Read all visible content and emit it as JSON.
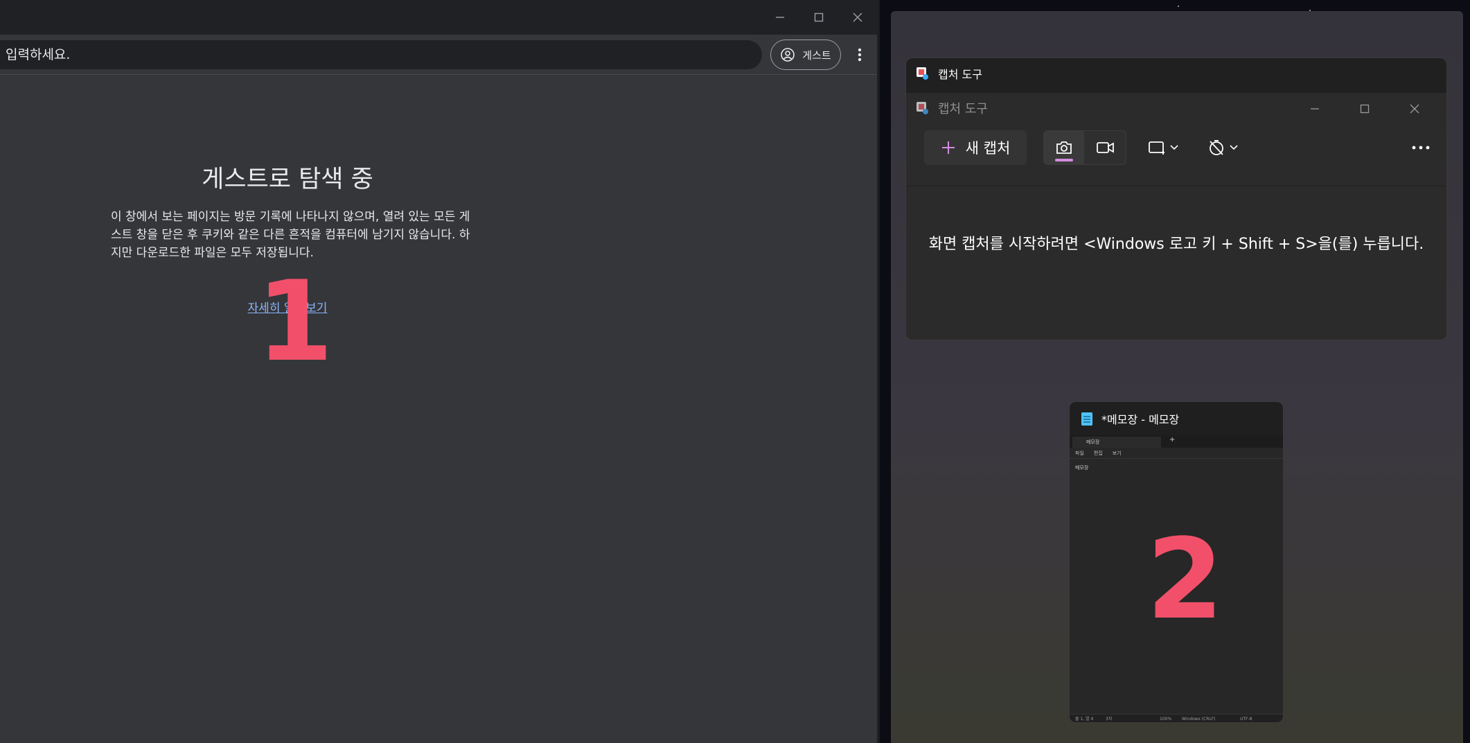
{
  "browser": {
    "omnibox_text": "입력하세요.",
    "guest_chip_label": "게스트",
    "heading": "게스트로 탐색 중",
    "description": "이 창에서 보는 페이지는 방문 기록에 나타나지 않으며, 열려 있는 모든 게스트 창을 닫은 후 쿠키와 같은 다른 흔적을 컴퓨터에 남기지 않습니다. 하지만 다운로드한 파일은 모두 저장됩니다.",
    "learn_more": "자세히 알아보기",
    "marker": "1"
  },
  "snipping_tool": {
    "thumb_title": "캡처 도구",
    "app_title": "캡처 도구",
    "new_capture_label": "새 캡처",
    "hint": "화면 캡처를 시작하려면 <Windows 로고 키 + Shift + S>을(를) 누릅니다.",
    "accent_color": "#d18ee0"
  },
  "notepad": {
    "thumb_title": "*메모장 - 메모장",
    "tab_label": "메모장",
    "menu": [
      "파일",
      "편집",
      "보기"
    ],
    "body_text": "메모장",
    "status": {
      "position": "줄 1, 열 4",
      "chars": "3자",
      "zoom": "100%",
      "line_ending": "Windows (CRLF)",
      "encoding": "UTF-8"
    },
    "marker": "2"
  },
  "colors": {
    "marker": "#f2506a",
    "link": "#8ab4f8"
  }
}
